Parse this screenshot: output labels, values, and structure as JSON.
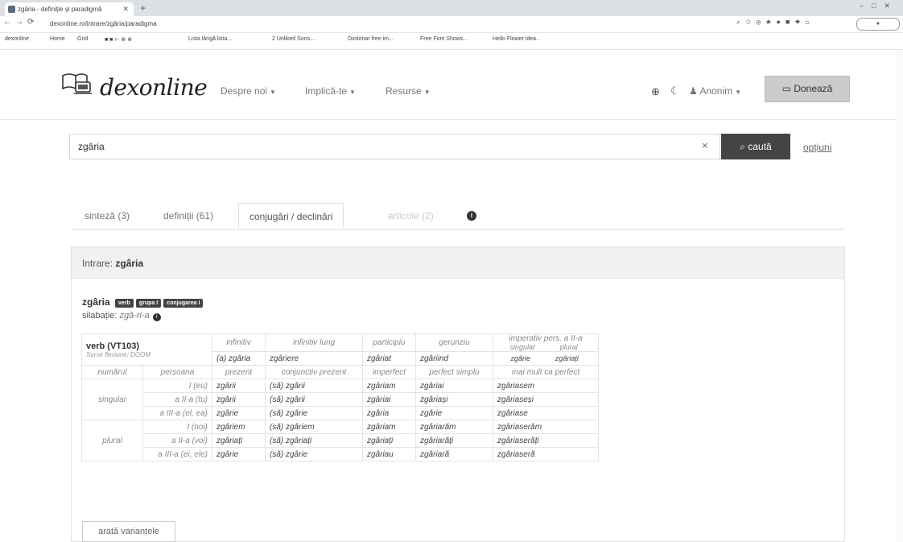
{
  "browser": {
    "tab_title": "zgâria - definiție și paradigmă",
    "new_tab": "+",
    "url": "dexonline.ro/intrare/zgâria/paradigma",
    "bookmarks": [
      "dexonline",
      "Home",
      "Grid",
      "Lista lângă lista...",
      "2 Unliked Sons...",
      "Dictionar free im...",
      "Free Font Shows...",
      "Hello Flower idea..."
    ]
  },
  "header": {
    "logo": "dexonline",
    "nav": [
      "Despre noi",
      "Implică-te",
      "Resurse"
    ],
    "user": "Anonim",
    "donate": "Donează"
  },
  "search": {
    "value": "zgâria",
    "button": "caută",
    "options": "opțiuni"
  },
  "tabs": [
    {
      "label": "sinteză (3)"
    },
    {
      "label": "definiții (61)"
    },
    {
      "label": "conjugări / declinări"
    },
    {
      "label": "articole (2)"
    }
  ],
  "entry": {
    "label": "Intrare:",
    "word": "zgâria",
    "lexeme": "zgâria",
    "badges": [
      "verb",
      "grupa I",
      "conjugarea I"
    ],
    "syll_label": "silabație:",
    "syll_value": "zgâ-ri-a"
  },
  "conjugation": {
    "model": "verb (VT103)",
    "source": "Surse flexiune: DOOM",
    "headers": {
      "infinitive": "infinitiv",
      "long_infinitive": "infinitiv lung",
      "participle": "participiu",
      "gerund": "gerunziu",
      "imperative": "imperativ pers. a II-a",
      "imp_singular": "singular",
      "imp_plural": "plural"
    },
    "top_forms": {
      "infinitive": "(a) zgâria",
      "long_infinitive": "zgâriere",
      "participle": "zgâriat",
      "gerund": "zgâriind",
      "imp_singular": "zgârie",
      "imp_plural": "zgâriați"
    },
    "tense_headers": [
      "numărul",
      "persoana",
      "prezent",
      "conjunctiv prezent",
      "imperfect",
      "perfect simplu",
      "mai mult ca perfect"
    ],
    "numbers": [
      "singular",
      "plural"
    ],
    "rows": [
      {
        "person": "I (eu)",
        "forms": [
          "zgârii",
          "(să) zgârii",
          "zgâriam",
          "zgâriai",
          "zgâriasem"
        ]
      },
      {
        "person": "a II-a (tu)",
        "forms": [
          "zgârii",
          "(să) zgârii",
          "zgâriai",
          "zgâriași",
          "zgâriaseși"
        ]
      },
      {
        "person": "a III-a (el, ea)",
        "forms": [
          "zgârie",
          "(să) zgârie",
          "zgâria",
          "zgârie",
          "zgâriase"
        ]
      },
      {
        "person": "I (noi)",
        "forms": [
          "zgâriem",
          "(să) zgâriem",
          "zgâriam",
          "zgâriarăm",
          "zgâriaserăm"
        ]
      },
      {
        "person": "a II-a (voi)",
        "forms": [
          "zgâriați",
          "(să) zgâriați",
          "zgâriați",
          "zgâriarăți",
          "zgâriaserăți"
        ]
      },
      {
        "person": "a III-a (ei, ele)",
        "forms": [
          "zgârie",
          "(să) zgârie",
          "zgâriau",
          "zgâriară",
          "zgâriaseră"
        ]
      }
    ]
  },
  "variants_button": "arată variantele"
}
